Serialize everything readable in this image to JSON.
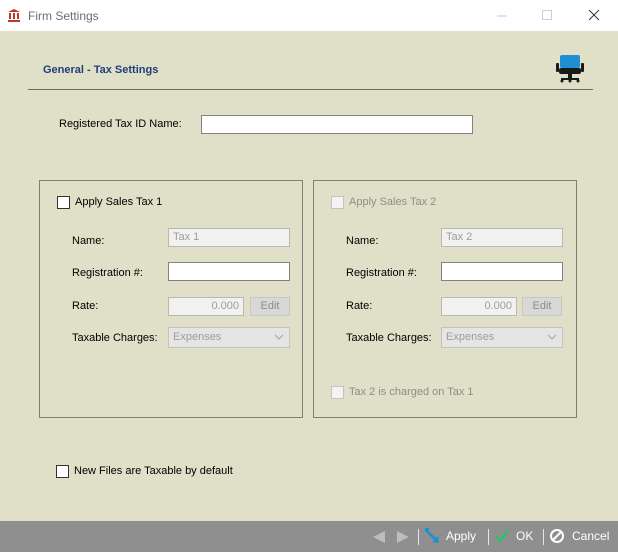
{
  "window": {
    "title": "Firm Settings"
  },
  "section": {
    "title": "General -  Tax Settings"
  },
  "registered_tax_id": {
    "label": "Registered Tax ID Name:",
    "value": ""
  },
  "tax1": {
    "apply_label": "Apply Sales Tax 1",
    "checked": false,
    "name_label": "Name:",
    "name_value": "Tax 1",
    "registration_label": "Registration #:",
    "registration_value": "",
    "rate_label": "Rate:",
    "rate_value": "0.000",
    "edit_label": "Edit",
    "charges_label": "Taxable Charges:",
    "charges_value": "Expenses"
  },
  "tax2": {
    "apply_label": "Apply Sales Tax 2",
    "checked": false,
    "name_label": "Name:",
    "name_value": "Tax 2",
    "registration_label": "Registration #:",
    "registration_value": "",
    "rate_label": "Rate:",
    "rate_value": "0.000",
    "edit_label": "Edit",
    "charges_label": "Taxable Charges:",
    "charges_value": "Expenses",
    "compound_label": "Tax 2 is charged on Tax 1"
  },
  "new_files": {
    "label": "New Files are Taxable by default",
    "checked": false
  },
  "footer": {
    "apply_label": "Apply",
    "ok_label": "OK",
    "cancel_label": "Cancel"
  },
  "colors": {
    "background": "#e0dfc8",
    "section_title": "#1f3f7a",
    "footer_bar": "#8f8f8f",
    "accent_blue": "#1e8fd5"
  }
}
